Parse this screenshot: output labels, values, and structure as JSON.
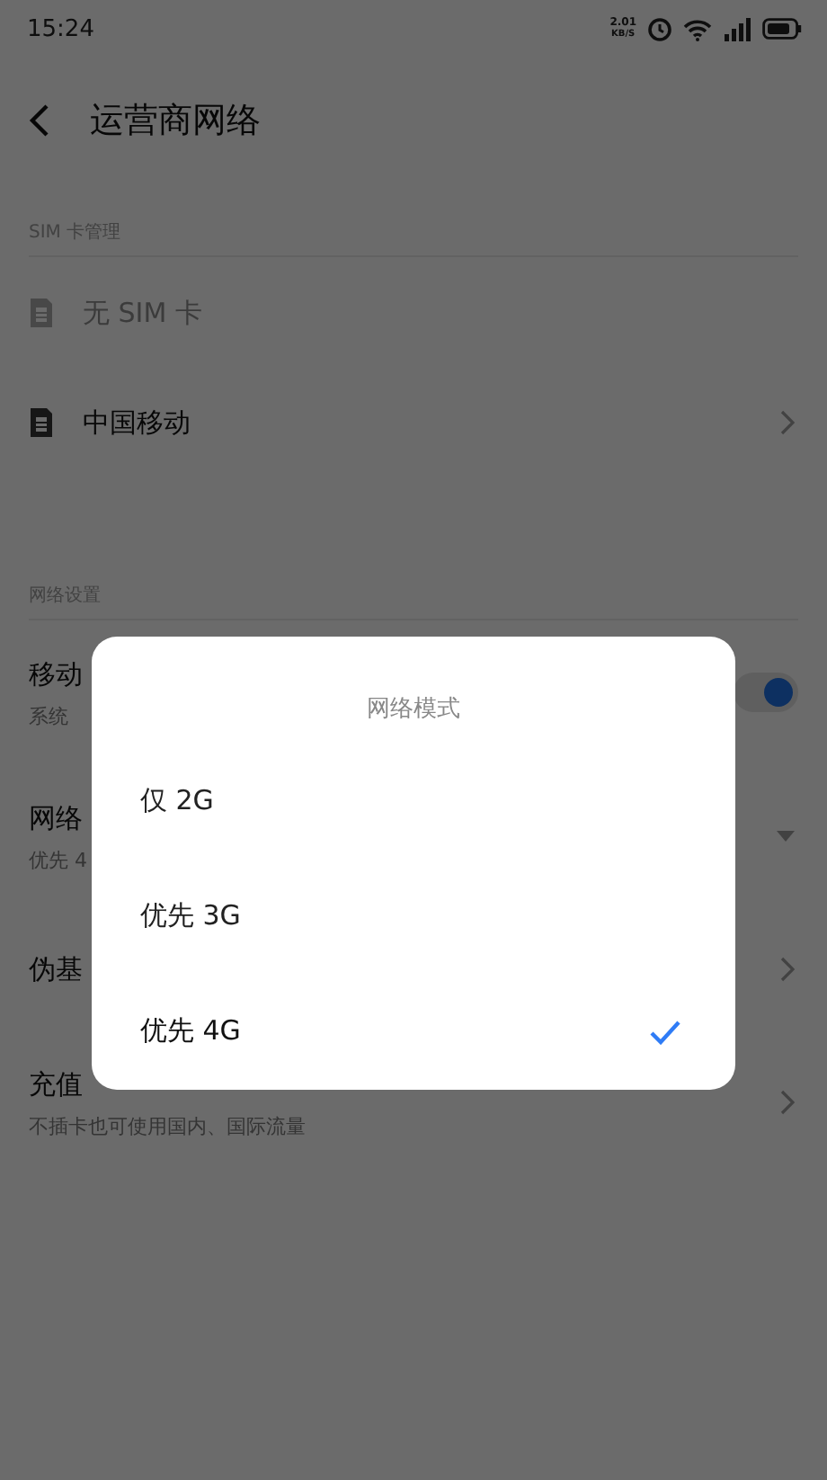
{
  "status_bar": {
    "time": "15:24",
    "net_speed": "2.01",
    "net_unit": "KB/S"
  },
  "header": {
    "title": "运营商网络"
  },
  "sections": [
    {
      "title": "SIM 卡管理",
      "items": [
        {
          "kind": "sim",
          "label": "无 SIM 卡",
          "disabled": true
        },
        {
          "kind": "sim",
          "label": "中国移动",
          "disabled": false
        }
      ]
    },
    {
      "title": "网络设置",
      "items": [
        {
          "kind": "toggle",
          "label": "移动",
          "subtitle": "系统",
          "on": true
        },
        {
          "kind": "dropdown",
          "label": "网络",
          "subtitle": "优先 4"
        },
        {
          "kind": "link",
          "label": "伪基"
        },
        {
          "kind": "link",
          "label": "充值",
          "subtitle": "不插卡也可使用国内、国际流量"
        }
      ]
    }
  ],
  "dialog": {
    "title": "网络模式",
    "options": [
      {
        "label": "仅 2G",
        "selected": false
      },
      {
        "label": "优先 3G",
        "selected": false
      },
      {
        "label": "优先 4G",
        "selected": true
      }
    ]
  }
}
